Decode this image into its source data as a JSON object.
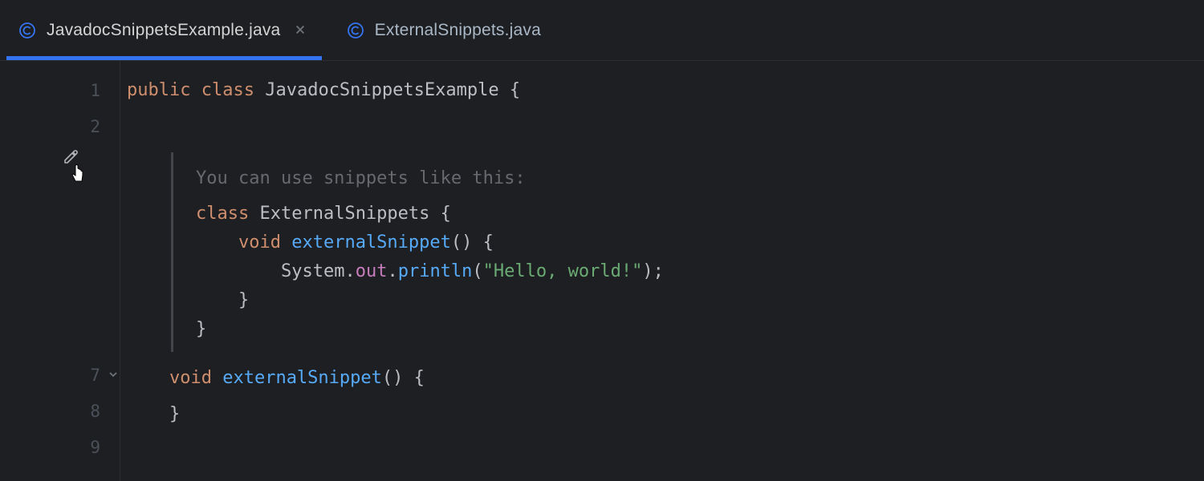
{
  "tabs": [
    {
      "label": "JavadocSnippetsExample.java",
      "active": true,
      "closable": true
    },
    {
      "label": "ExternalSnippets.java",
      "active": false,
      "closable": false
    }
  ],
  "gutter": {
    "lines": [
      "1",
      "2",
      "",
      "7",
      "8",
      "9"
    ]
  },
  "code": {
    "line1": {
      "kw_public": "public",
      "kw_class": "class",
      "classname": "JavadocSnippetsExample",
      "brace": "{"
    },
    "doc": {
      "text": "You can use snippets like this:",
      "snippet": {
        "l1_kw": "class",
        "l1_name": "ExternalSnippets",
        "l1_brace": " {",
        "l2_kw": "void",
        "l2_name": "externalSnippet",
        "l2_paren": "() {",
        "l3_sys": "System",
        "l3_dot1": ".",
        "l3_out": "out",
        "l3_dot2": ".",
        "l3_println": "println",
        "l3_open": "(",
        "l3_str": "\"Hello, world!\"",
        "l3_close": ");",
        "l4": "    }",
        "l5": "}"
      }
    },
    "line7": {
      "kw_void": "void",
      "method": "externalSnippet",
      "paren": "() {"
    },
    "line8": "    }"
  },
  "colors": {
    "accent": "#3574f0",
    "bg": "#1e1f22"
  }
}
